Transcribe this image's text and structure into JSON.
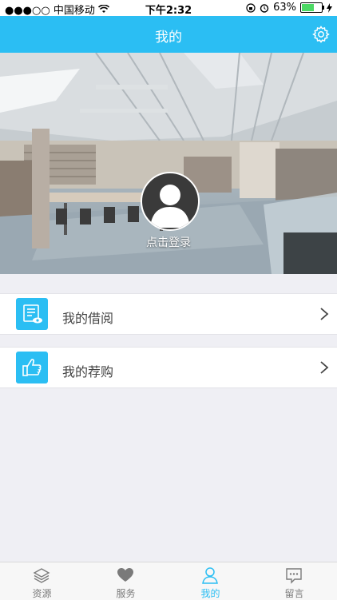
{
  "status_bar": {
    "carrier": "●●●○○ 中国移动",
    "time": "下午2:32",
    "battery": "63%",
    "battery_level": 0.63
  },
  "nav": {
    "title": "我的",
    "settings_icon": "gear-icon"
  },
  "profile": {
    "login_text": "点击登录"
  },
  "menu": [
    {
      "label": "我的借阅",
      "icon": "book-list-icon"
    },
    {
      "label": "我的荐购",
      "icon": "thumbs-up-icon"
    }
  ],
  "tabs": [
    {
      "label": "资源",
      "icon": "layers-icon",
      "active": false
    },
    {
      "label": "服务",
      "icon": "heart-icon",
      "active": false
    },
    {
      "label": "我的",
      "icon": "person-icon",
      "active": true
    },
    {
      "label": "留言",
      "icon": "message-icon",
      "active": false
    }
  ],
  "colors": {
    "accent": "#2bbef3",
    "background": "#efeff4"
  }
}
